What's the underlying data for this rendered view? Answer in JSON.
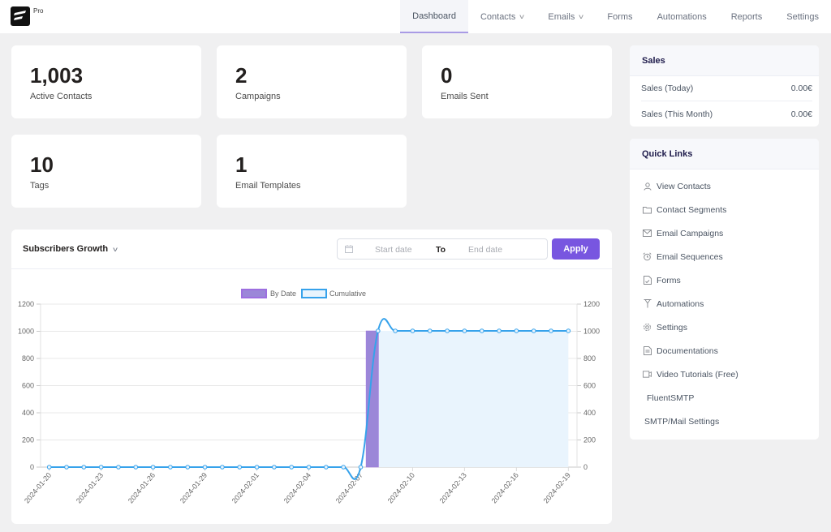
{
  "app": {
    "logo_badge": "Pro"
  },
  "nav": {
    "items": [
      {
        "label": "Dashboard",
        "active": true,
        "dropdown": false
      },
      {
        "label": "Contacts",
        "active": false,
        "dropdown": true
      },
      {
        "label": "Emails",
        "active": false,
        "dropdown": true
      },
      {
        "label": "Forms",
        "active": false,
        "dropdown": false
      },
      {
        "label": "Automations",
        "active": false,
        "dropdown": false
      },
      {
        "label": "Reports",
        "active": false,
        "dropdown": false
      },
      {
        "label": "Settings",
        "active": false,
        "dropdown": false
      }
    ]
  },
  "stats": [
    {
      "value": "1,003",
      "label": "Active Contacts"
    },
    {
      "value": "2",
      "label": "Campaigns"
    },
    {
      "value": "0",
      "label": "Emails Sent"
    },
    {
      "value": "10",
      "label": "Tags"
    },
    {
      "value": "1",
      "label": "Email Templates"
    }
  ],
  "sales": {
    "title": "Sales",
    "rows": [
      {
        "label": "Sales (Today)",
        "value": "0.00€"
      },
      {
        "label": "Sales (This Month)",
        "value": "0.00€"
      }
    ]
  },
  "quick_links": {
    "title": "Quick Links",
    "items": [
      {
        "label": "View Contacts",
        "icon": "user-icon"
      },
      {
        "label": "Contact Segments",
        "icon": "folder-icon"
      },
      {
        "label": "Email Campaigns",
        "icon": "envelope-icon"
      },
      {
        "label": "Email Sequences",
        "icon": "alarm-clock-icon"
      },
      {
        "label": "Forms",
        "icon": "form-document-icon"
      },
      {
        "label": "Automations",
        "icon": "funnel-icon"
      },
      {
        "label": "Settings",
        "icon": "gear-icon"
      },
      {
        "label": "Documentations",
        "icon": "document-icon"
      },
      {
        "label": "Video Tutorials (Free)",
        "icon": "video-camera-icon"
      },
      {
        "label": "FluentSMTP",
        "icon": ""
      },
      {
        "label": "SMTP/Mail Settings",
        "icon": ""
      }
    ]
  },
  "chart_panel": {
    "title": "Subscribers Growth",
    "start_placeholder": "Start date",
    "to_label": "To",
    "end_placeholder": "End date",
    "apply_label": "Apply"
  },
  "colors": {
    "accent": "#7856e0",
    "bar_fill": "#9b87d8",
    "bar_border": "#9d6fe0",
    "line": "#36a2eb",
    "area_fill": "#e9f4fd"
  },
  "chart_data": {
    "type": "bar",
    "title": "",
    "xlabel": "",
    "ylabel": "",
    "ylim": [
      0,
      1200
    ],
    "y_ticks": [
      0,
      200,
      400,
      600,
      800,
      1000,
      1200
    ],
    "grid": true,
    "legend_position": "top-center",
    "x": [
      "2024-01-20",
      "2024-01-21",
      "2024-01-22",
      "2024-01-23",
      "2024-01-24",
      "2024-01-25",
      "2024-01-26",
      "2024-01-27",
      "2024-01-28",
      "2024-01-29",
      "2024-01-30",
      "2024-01-31",
      "2024-02-01",
      "2024-02-02",
      "2024-02-03",
      "2024-02-04",
      "2024-02-05",
      "2024-02-06",
      "2024-02-07",
      "2024-02-08",
      "2024-02-09",
      "2024-02-10",
      "2024-02-11",
      "2024-02-12",
      "2024-02-13",
      "2024-02-14",
      "2024-02-15",
      "2024-02-16",
      "2024-02-17",
      "2024-02-18",
      "2024-02-19"
    ],
    "x_tick_labels": [
      "2024-01-20",
      "2024-01-23",
      "2024-01-26",
      "2024-01-29",
      "2024-02-01",
      "2024-02-04",
      "2024-02-07",
      "2024-02-10",
      "2024-02-13",
      "2024-02-16",
      "2024-02-19"
    ],
    "series": [
      {
        "name": "By Date",
        "type": "bar",
        "values": [
          0,
          0,
          0,
          0,
          0,
          0,
          0,
          0,
          0,
          0,
          0,
          0,
          0,
          0,
          0,
          0,
          0,
          0,
          0,
          1003,
          0,
          0,
          0,
          0,
          0,
          0,
          0,
          0,
          0,
          0,
          0
        ]
      },
      {
        "name": "Cumulative",
        "type": "line",
        "values": [
          0,
          0,
          0,
          0,
          0,
          0,
          0,
          0,
          0,
          0,
          0,
          0,
          0,
          0,
          0,
          0,
          0,
          0,
          0,
          1003,
          1003,
          1003,
          1003,
          1003,
          1003,
          1003,
          1003,
          1003,
          1003,
          1003,
          1003
        ]
      }
    ]
  }
}
